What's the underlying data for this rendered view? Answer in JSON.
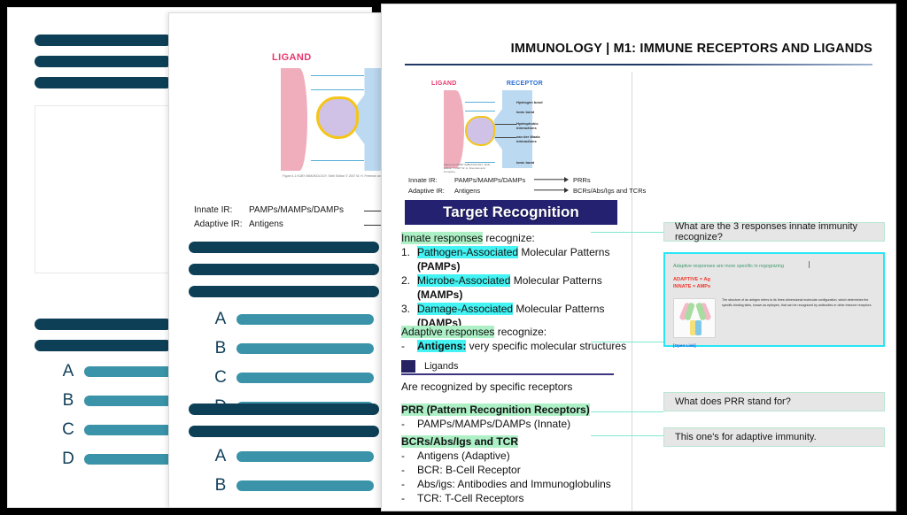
{
  "header": {
    "title": "IMMUNOLOGY | M1: IMMUNE RECEPTORS AND LIGANDS"
  },
  "diagram": {
    "ligand_label": "LIGAND",
    "receptor_label": "RECEPTOR",
    "annotations": [
      "Hydrogen bond",
      "Ionic bond",
      "Hydrophobic interactions",
      "van der Waals interactions",
      "Ionic bond"
    ],
    "caption": "Figure 4-1  KUBY IMMUNOLOGY, Sixth Edition  © 2007 W. H. Freeman and Company"
  },
  "ir_table": {
    "rows": [
      {
        "key": "Innate IR:",
        "value": "PAMPs/MAMPs/DAMPs",
        "target": "PRRs"
      },
      {
        "key": "Adaptive IR:",
        "value": "Antigens",
        "target": "BCRs/Abs/Igs and TCRs"
      }
    ]
  },
  "banner": {
    "title": "Target Recognition"
  },
  "innate": {
    "intro_hl": "Innate responses",
    "intro_rest": " recognize:",
    "items": [
      {
        "num": "1.",
        "hl": "Pathogen-Associated",
        "rest": " Molecular Patterns",
        "sub": "(PAMPs)"
      },
      {
        "num": "2.",
        "hl": "Microbe-Associated",
        "rest": " Molecular Patterns",
        "sub": "(MAMPs)"
      },
      {
        "num": "3.",
        "hl": "Damage-Associated",
        "rest": " Molecular Patterns",
        "sub": "(DAMPs)"
      }
    ]
  },
  "adaptive": {
    "intro_hl": "Adaptive responses",
    "intro_rest": " recognize:",
    "dash": "-",
    "item_hl": "Antigens:",
    "item_rest": " very specific molecular structures"
  },
  "ligands_section": {
    "title": "Ligands",
    "subtitle": "Are recognized by specific receptors",
    "prr_heading": "PRR (Pattern Recognition Receptors)",
    "prr_items": [
      {
        "dash": "-",
        "text": "PAMPs/MAMPs/DAMPs (Innate)"
      }
    ],
    "bcr_heading": "BCRs/Abs/Igs and TCR",
    "bcr_items": [
      {
        "dash": "-",
        "text": "Antigens (Adaptive)"
      },
      {
        "dash": "-",
        "text": "BCR: B-Cell Receptor"
      },
      {
        "dash": "-",
        "text": "Abs/igs: Antibodies and Immunoglobulins"
      },
      {
        "dash": "-",
        "text": "TCR: T-Cell Receptors"
      }
    ]
  },
  "rail": {
    "card_innate": "What are the 3 responses innate immunity recognize?",
    "card_prr": "What does PRR stand for?",
    "card_adaptive": "This one's for adaptive immunity.",
    "note": {
      "line1": "Adaptive responses are more specific in regognizing",
      "red_line1": "ADAPTIVE = Ag",
      "red_line2": "INNATE = AMPs",
      "body": "The structure of an antigen refers to its three-dimensional molecular configuration, which determines the specific binding sites, known as epitopes, that can be recognized by antibodies or other immune receptors.",
      "link": "[Open Link]"
    }
  },
  "mid_slide": {
    "ligand_label": "LIGAND",
    "ir_rows": [
      {
        "key": "Innate IR:",
        "value": "PAMPs/MAMPs/DAMPs"
      },
      {
        "key": "Adaptive IR:",
        "value": "Antigens"
      }
    ],
    "choices_top": [
      "A",
      "B",
      "C",
      "D"
    ],
    "choices_bottom": [
      "A",
      "B"
    ]
  },
  "back_slide": {
    "choices": [
      "A",
      "B",
      "C",
      "D"
    ]
  },
  "colors": {
    "bar_dark": "#0d3f56",
    "bar_light": "#3a93a8",
    "banner": "#232170",
    "highlight_cyan": "#44f3f3",
    "highlight_green": "#adf0c6",
    "note_border": "#27e6f5",
    "card_bg": "#e6e6e6",
    "link": "#2b5fd9"
  }
}
